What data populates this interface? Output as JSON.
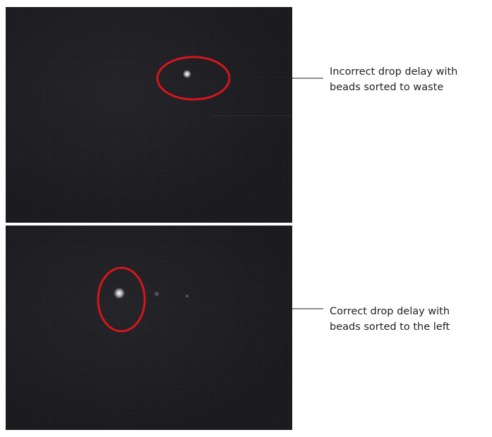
{
  "figure": {
    "top_image": {
      "description_label_line1": "Incorrect drop delay with",
      "description_label_line2": "beads sorted to waste"
    },
    "bottom_image": {
      "description_label_line1": "Correct drop delay with",
      "description_label_line2": "beads sorted to the left"
    },
    "colors": {
      "highlight_ellipse": "#d4161c",
      "leader_line": "#222222",
      "image_background": "#1c1b1f",
      "bead_spot": "#ffffff"
    }
  }
}
